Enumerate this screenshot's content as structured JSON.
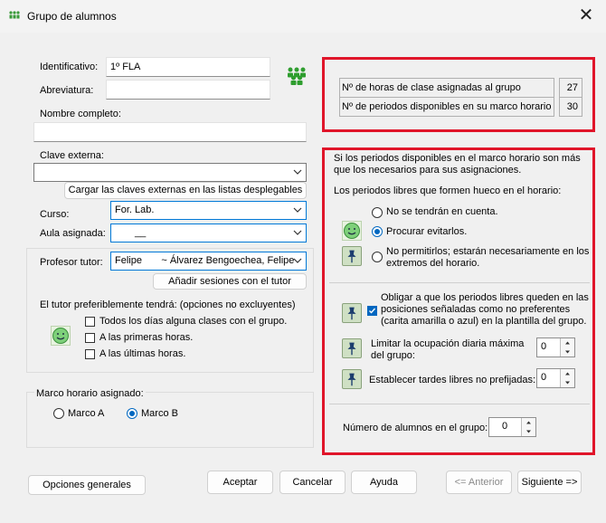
{
  "window": {
    "title": "Grupo de alumnos",
    "close_glyph": "✕"
  },
  "icons": {
    "title": "students-group-icon",
    "group": "people-icon",
    "tutor": "smiley-icon",
    "pin": "pushpin-icon"
  },
  "colors": {
    "accent": "#0067c0",
    "highlight": "#e0152a",
    "group_green": "#2f9e2f"
  },
  "form": {
    "identificativo_label": "Identificativo:",
    "identificativo_value": "1º FLA",
    "abreviatura_label": "Abreviatura:",
    "abreviatura_value": "",
    "nombre_label": "Nombre completo:",
    "nombre_value": "",
    "clave_label": "Clave externa:",
    "clave_value": "",
    "cargar_button": "Cargar las claves externas en las listas desplegables",
    "curso_label": "Curso:",
    "curso_value": "For. Lab.",
    "aula_label": "Aula asignada:",
    "aula_value": "__",
    "tutor_label": "Profesor tutor:",
    "tutor_value": "Felipe       ~ Álvarez Bengoechea, Felipe",
    "anadir_button": "Añadir sesiones con el tutor",
    "tutor_pref_label": "El tutor preferiblemente tendrá: (opciones no excluyentes)",
    "tutor_opts": [
      "Todos los días alguna clases con el grupo.",
      "A las primeras horas.",
      "A las últimas horas."
    ],
    "marco_label": "Marco horario asignado:",
    "marco_a": "Marco A",
    "marco_b": "Marco B"
  },
  "stats": {
    "horas_label": "Nº de horas de clase asignadas al grupo",
    "horas_value": "27",
    "periodos_label": "Nº de periodos disponibles en su marco horario",
    "periodos_value": "30"
  },
  "options": {
    "intro": "Si los periodos disponibles en el marco horario son más que los necesarios para sus asignaciones.",
    "libres_label": "Los periodos libres que formen hueco en el horario:",
    "radio_1": "No se tendrán en cuenta.",
    "radio_2": "Procurar evitarlos.",
    "radio_3": "No permitirlos; estarán necesariamente en los extremos del horario.",
    "obligar_label": "Obligar a que los periodos libres queden en las posiciones señaladas como no preferentes (carita amarilla o azul) en la plantilla del grupo.",
    "limitar_label": "Limitar la ocupación diaria máxima del grupo:",
    "limitar_value": "0",
    "tardes_label": "Establecer tardes libres no prefijadas:",
    "tardes_value": "0",
    "alumnos_label": "Número de alumnos en el grupo:",
    "alumnos_value": "0"
  },
  "footer": {
    "opciones": "Opciones generales",
    "aceptar": "Aceptar",
    "cancelar": "Cancelar",
    "ayuda": "Ayuda",
    "anterior": "<= Anterior",
    "siguiente": "Siguiente =>"
  }
}
